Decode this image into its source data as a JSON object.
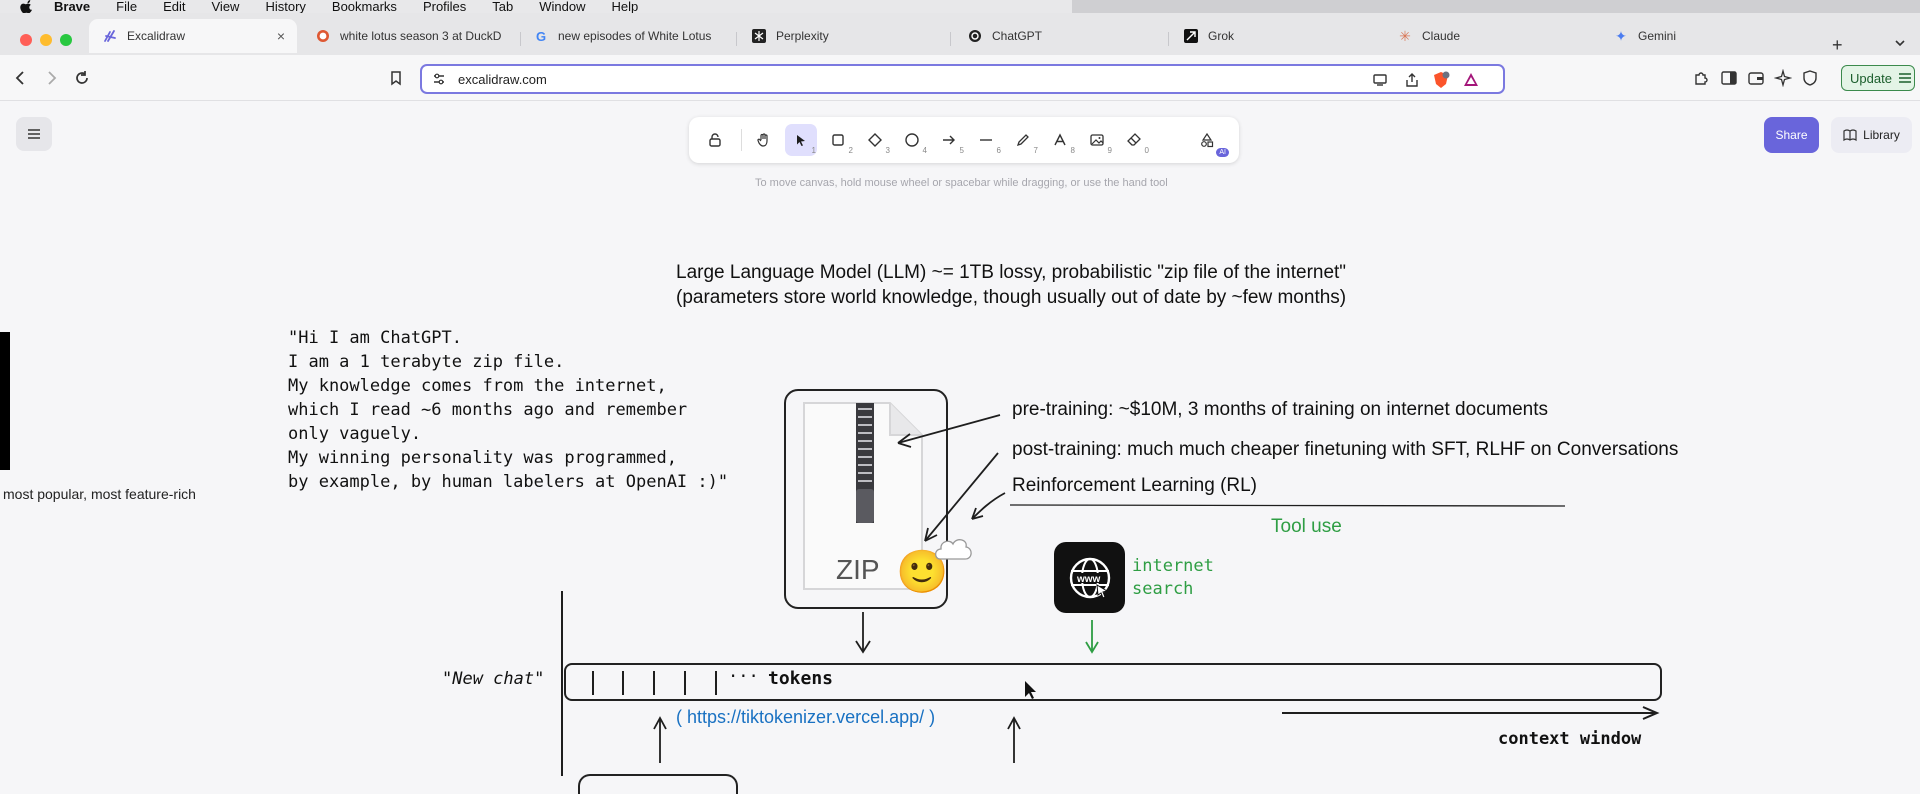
{
  "menubar": {
    "app": "Brave",
    "items": [
      "File",
      "Edit",
      "View",
      "History",
      "Bookmarks",
      "Profiles",
      "Tab",
      "Window",
      "Help"
    ]
  },
  "tabs": [
    {
      "title": "Excalidraw",
      "icon": "excalidraw-icon",
      "active": true
    },
    {
      "title": "white lotus season 3 at DuckD",
      "icon": "duckduckgo-icon"
    },
    {
      "title": "new episodes of White Lotus",
      "icon": "google-icon"
    },
    {
      "title": "Perplexity",
      "icon": "perplexity-icon"
    },
    {
      "title": "ChatGPT",
      "icon": "chatgpt-icon"
    },
    {
      "title": "Grok",
      "icon": "grok-icon"
    },
    {
      "title": "Claude",
      "icon": "claude-icon"
    },
    {
      "title": "Gemini",
      "icon": "gemini-icon"
    }
  ],
  "newtab_label": "+",
  "close_glyph": "×",
  "address": {
    "url": "excalidraw.com"
  },
  "update_label": "Update",
  "toolbar": {
    "tools": [
      {
        "name": "lock",
        "num": ""
      },
      {
        "name": "hand",
        "num": ""
      },
      {
        "name": "selection",
        "num": "1"
      },
      {
        "name": "rectangle",
        "num": "2"
      },
      {
        "name": "diamond",
        "num": "3"
      },
      {
        "name": "ellipse",
        "num": "4"
      },
      {
        "name": "arrow",
        "num": "5"
      },
      {
        "name": "line",
        "num": "6"
      },
      {
        "name": "draw",
        "num": "7"
      },
      {
        "name": "text",
        "num": "8"
      },
      {
        "name": "image",
        "num": "9"
      },
      {
        "name": "eraser",
        "num": "0"
      },
      {
        "name": "more-tools",
        "num": ""
      }
    ],
    "badge": "AI",
    "hint": "To move canvas, hold mouse wheel or spacebar while dragging, or use the hand tool"
  },
  "share_label": "Share",
  "library_label": "Library",
  "drawing": {
    "side_note": "most popular, most feature-rich",
    "llm_line1": "Large Language Model (LLM) ~= 1TB lossy, probabilistic \"zip file of the internet\"",
    "llm_line2": "(parameters store world knowledge, though usually out of date by ~few months)",
    "quote_lines": [
      "\"Hi I am ChatGPT.",
      "I am a 1 terabyte zip file.",
      "My knowledge comes from the internet,",
      "which I read ~6 months ago and remember",
      "only vaguely.",
      "My winning personality was programmed,",
      "by example, by human labelers at OpenAI :)\""
    ],
    "pretraining": "pre-training: ~$10M, 3 months of training on internet documents",
    "posttraining": "post-training: much much cheaper finetuning with SFT, RLHF on Conversations",
    "rl": "Reinforcement Learning (RL)",
    "tool_use": "Tool use",
    "zip_label": "ZIP",
    "smiley": "🙂",
    "internet_search_1": "internet",
    "internet_search_2": "search",
    "new_chat": "\"New chat\"",
    "dots": "...",
    "tokens": "tokens",
    "tiktokenizer": "( https://tiktokenizer.vercel.app/ )",
    "context_window": "context window"
  },
  "colors": {
    "accent": "#6965db",
    "green": "#2f9e44",
    "link_blue": "#1971c2",
    "ink": "#1e1e1e"
  }
}
